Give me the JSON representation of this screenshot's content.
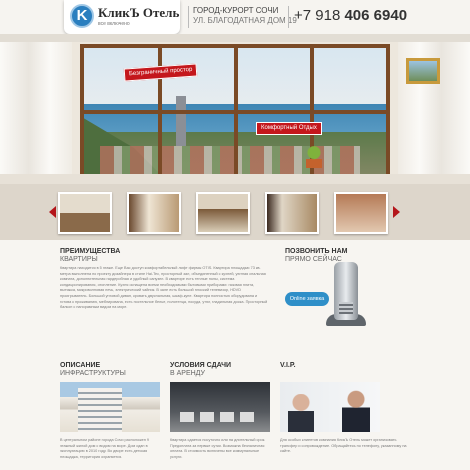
{
  "header": {
    "logo_letter": "K",
    "logo_name": "КликЪ Отель",
    "logo_tagline": "все включено",
    "address_city": "ГОРОД-КУРОРТ СОЧИ",
    "address_street": "УЛ. БЛАГОДАТНАЯ ДОМ 19",
    "phone_prefix": "+7 918 ",
    "phone_number": "406 6940"
  },
  "hero": {
    "tag_space": "Безграничный простор",
    "tag_rest": "Комфортный Отдых"
  },
  "gallery": {
    "thumbnails": [
      "фото 1",
      "фото 2",
      "фото 3",
      "фото 4",
      "фото 5"
    ]
  },
  "advantages": {
    "title": "ПРЕИМУЩЕСТВА",
    "subtitle": "КВАРТИРЫ",
    "text": "Квартира находится в 5 этаже. Еще Вас доступ комфортабельный лифт фирмы OTIS. Квартира площадью 73 кв. метра выполнена по проекту дизайнера в стиле Hai-Tec, просторный зал, объединенный с кухней, уютная спальная комната, дополнительная гардеробная и удобный санузел. В квартире есть теплые полы, система кондиционирования, отопление. Кухня оснащена всеми необходимыми бытовыми приборами: газовая плита, вытяжка, микроволновая печь, электрический чайник. В зале есть большой плоский телевизор, HDVD проигрыватель. Большой угловой диван, кровать двуспальная, шкаф-купе. Квартира полностью оборудована и готова к проживанию, меблирована, есть постельное белье, полотенца, посуда, утюг, гладильная доска. Просторный балкон с панорамным видом на море."
  },
  "call": {
    "title": "ПОЗВОНИТЬ НАМ",
    "subtitle": "ПРЯМО СЕЙЧАС",
    "button": "Online заявка"
  },
  "columns": [
    {
      "title": "ОПИСАНИЕ",
      "subtitle": "ИНФРАСТРУКТУРЫ",
      "text": "В центральном районе города Сочи расположен 9 этажный жилой дом с видом на море. Дом сдан в эксплуатацию в 2010 году. Во дворе есть детская площадка, территория охраняется."
    },
    {
      "title": "УСЛОВИЯ СДАЧИ",
      "subtitle": "В АРЕНДУ",
      "text": "Квартира сдается посуточно или на длительный срок. Предоплата за первые сутки. Возможна безналичная оплата. В стоимость включены все коммунальные услуги."
    },
    {
      "title": "V.I.P.",
      "subtitle": "",
      "text": "Для особых клиентов компания КликЪ Отель может организовать трансфер и сопровождение. Обращайтесь по телефону, указанному на сайте."
    }
  ]
}
